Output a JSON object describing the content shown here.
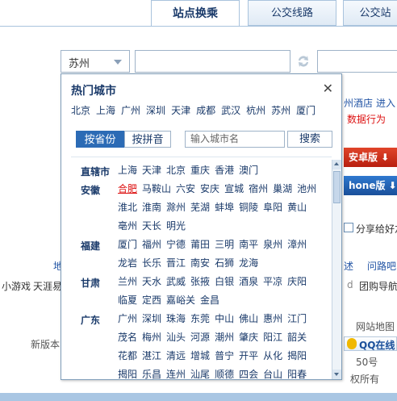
{
  "tabs": [
    {
      "label": "站点换乘",
      "active": true
    },
    {
      "label": "公交线路",
      "active": false
    },
    {
      "label": "公交站",
      "active": false
    }
  ],
  "city_select": {
    "value": "苏州"
  },
  "background": {
    "right_links": [
      "州酒店",
      "进入"
    ],
    "right_red": "数据行为",
    "download_buttons": [
      "安卓版",
      "hone版"
    ],
    "share": "分享给好友",
    "left_fragments": [
      "地",
      "小游戏",
      "天涯易"
    ],
    "right_fragments": [
      "述",
      "问路吧",
      "团购导航"
    ],
    "middle_fragment": "d",
    "website_map": "网站地图",
    "new_version": "新版本",
    "qq_online": "QQ在线",
    "address_suffix": "50号",
    "rights": "权所有"
  },
  "popup": {
    "title": "热门城市",
    "close": "✕",
    "hot_cities": [
      "北京",
      "上海",
      "广州",
      "深圳",
      "天津",
      "成都",
      "武汉",
      "杭州",
      "苏州",
      "厦门"
    ],
    "mode_province": "按省份",
    "mode_pinyin": "按拼音",
    "search_placeholder": "输入城市名",
    "search_button": "搜索",
    "groups": [
      {
        "province": "直辖市",
        "rows": [
          [
            "上海",
            "天津",
            "北京",
            "重庆",
            "香港",
            "澳门"
          ]
        ]
      },
      {
        "province": "安徽",
        "rows": [
          [
            "合肥",
            "马鞍山",
            "六安",
            "安庆",
            "宣城",
            "宿州",
            "巢湖",
            "池州"
          ],
          [
            "淮北",
            "淮南",
            "滁州",
            "芜湖",
            "蚌埠",
            "铜陵",
            "阜阳",
            "黄山"
          ],
          [
            "亳州",
            "天长",
            "明光"
          ]
        ]
      },
      {
        "province": "福建",
        "rows": [
          [
            "厦门",
            "福州",
            "宁德",
            "莆田",
            "三明",
            "南平",
            "泉州",
            "漳州"
          ],
          [
            "龙岩",
            "长乐",
            "晋江",
            "南安",
            "石狮",
            "龙海"
          ]
        ]
      },
      {
        "province": "甘肃",
        "rows": [
          [
            "兰州",
            "天水",
            "武威",
            "张掖",
            "白银",
            "酒泉",
            "平凉",
            "庆阳"
          ],
          [
            "临夏",
            "定西",
            "嘉峪关",
            "金昌"
          ]
        ]
      },
      {
        "province": "广东",
        "rows": [
          [
            "广州",
            "深圳",
            "珠海",
            "东莞",
            "中山",
            "佛山",
            "惠州",
            "江门"
          ],
          [
            "茂名",
            "梅州",
            "汕头",
            "河源",
            "潮州",
            "肇庆",
            "阳江",
            "韶关"
          ],
          [
            "花都",
            "湛江",
            "清远",
            "增城",
            "普宁",
            "开平",
            "从化",
            "揭阳"
          ],
          [
            "揭阳",
            "乐昌",
            "连州",
            "汕尾",
            "顺德",
            "四会",
            "台山",
            "阳春"
          ]
        ]
      }
    ],
    "selected_city": "合肥"
  },
  "colors": {
    "accent": "#2c6bb5",
    "link": "#1a3a6a",
    "selected": "#dd1111"
  }
}
